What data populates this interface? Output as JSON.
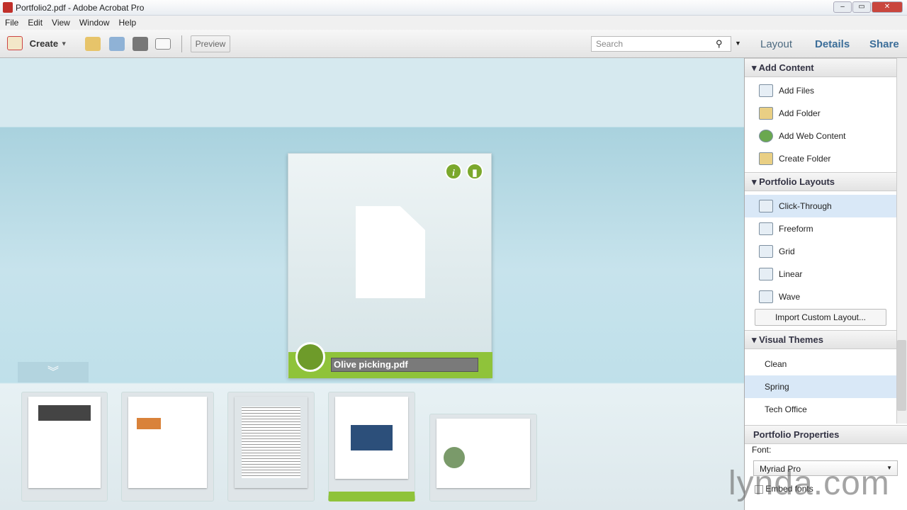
{
  "window": {
    "title": "Portfolio2.pdf - Adobe Acrobat Pro"
  },
  "menu": [
    "File",
    "Edit",
    "View",
    "Window",
    "Help"
  ],
  "toolbar": {
    "create_label": "Create",
    "preview_label": "Preview",
    "search_placeholder": "Search"
  },
  "tabs": [
    "Layout",
    "Details",
    "Share"
  ],
  "card": {
    "filename": "Olive picking.pdf",
    "info_glyph": "i"
  },
  "panel": {
    "add_content": {
      "title": "Add Content",
      "items": [
        "Add Files",
        "Add Folder",
        "Add Web Content",
        "Create Folder"
      ]
    },
    "layouts": {
      "title": "Portfolio Layouts",
      "items": [
        "Click-Through",
        "Freeform",
        "Grid",
        "Linear",
        "Wave"
      ],
      "selected": "Click-Through",
      "import_label": "Import Custom Layout..."
    },
    "themes": {
      "title": "Visual Themes",
      "items": [
        "Clean",
        "Spring",
        "Tech Office"
      ],
      "selected": "Spring"
    },
    "properties": {
      "title": "Portfolio Properties",
      "font_label": "Font:",
      "font_value": "Myriad Pro",
      "embed_label": "Embed fonts"
    }
  },
  "watermark": "lynda.com",
  "colors": {
    "accent_green": "#8fc33a",
    "tab_blue": "#3c6e99"
  }
}
